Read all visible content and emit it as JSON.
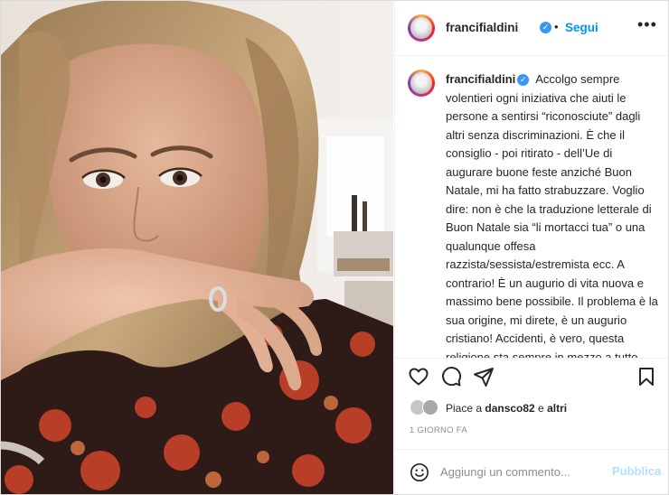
{
  "header": {
    "username": "francifialdini",
    "follow_label": "Segui",
    "separator": "•",
    "more_label": "•••"
  },
  "caption": {
    "username": "francifialdini",
    "text": "Accolgo sempre volentieri ogni iniziativa che aiuti le persone a sentirsi “riconosciute” dagli altri senza discriminazioni. È che il consiglio - poi ritirato - dell’Ue di augurare buone feste anziché Buon Natale, mi ha fatto strabuzzare. Voglio dire: non è che la traduzione letterale di Buon Natale sia “li mortacci tua” o una qualunque offesa razzista/sessista/estremista ecc. A contrario! È un augurio di vita nuova e massimo bene possibile. Il problema è la sua origine, mi direte, è un augurio cristiano! Accidenti, è vero, questa religione sta sempre in mezzo a tutto. Beh allora inventiamo un nuovo modo per chiamare questo periodo di festività e smettiamola di fare gli ipocriti perché o è Nata e per via della nascita di Gesù o"
  },
  "likes": {
    "prefix": "Piace a ",
    "user": "dansco82",
    "middle": " e ",
    "others": "altri"
  },
  "timestamp": "1 GIORNO FA",
  "comment": {
    "placeholder": "Aggiungi un commento...",
    "publish_label": "Pubblica"
  },
  "icons": {
    "verified": "verified-badge-icon",
    "like": "heart-icon",
    "comment": "comment-icon",
    "share": "paper-plane-icon",
    "save": "bookmark-icon",
    "emoji": "smiley-icon"
  },
  "colors": {
    "accent": "#0095f6",
    "publish_disabled": "#b2dffc",
    "text": "#262626",
    "muted": "#8e8e8e"
  }
}
